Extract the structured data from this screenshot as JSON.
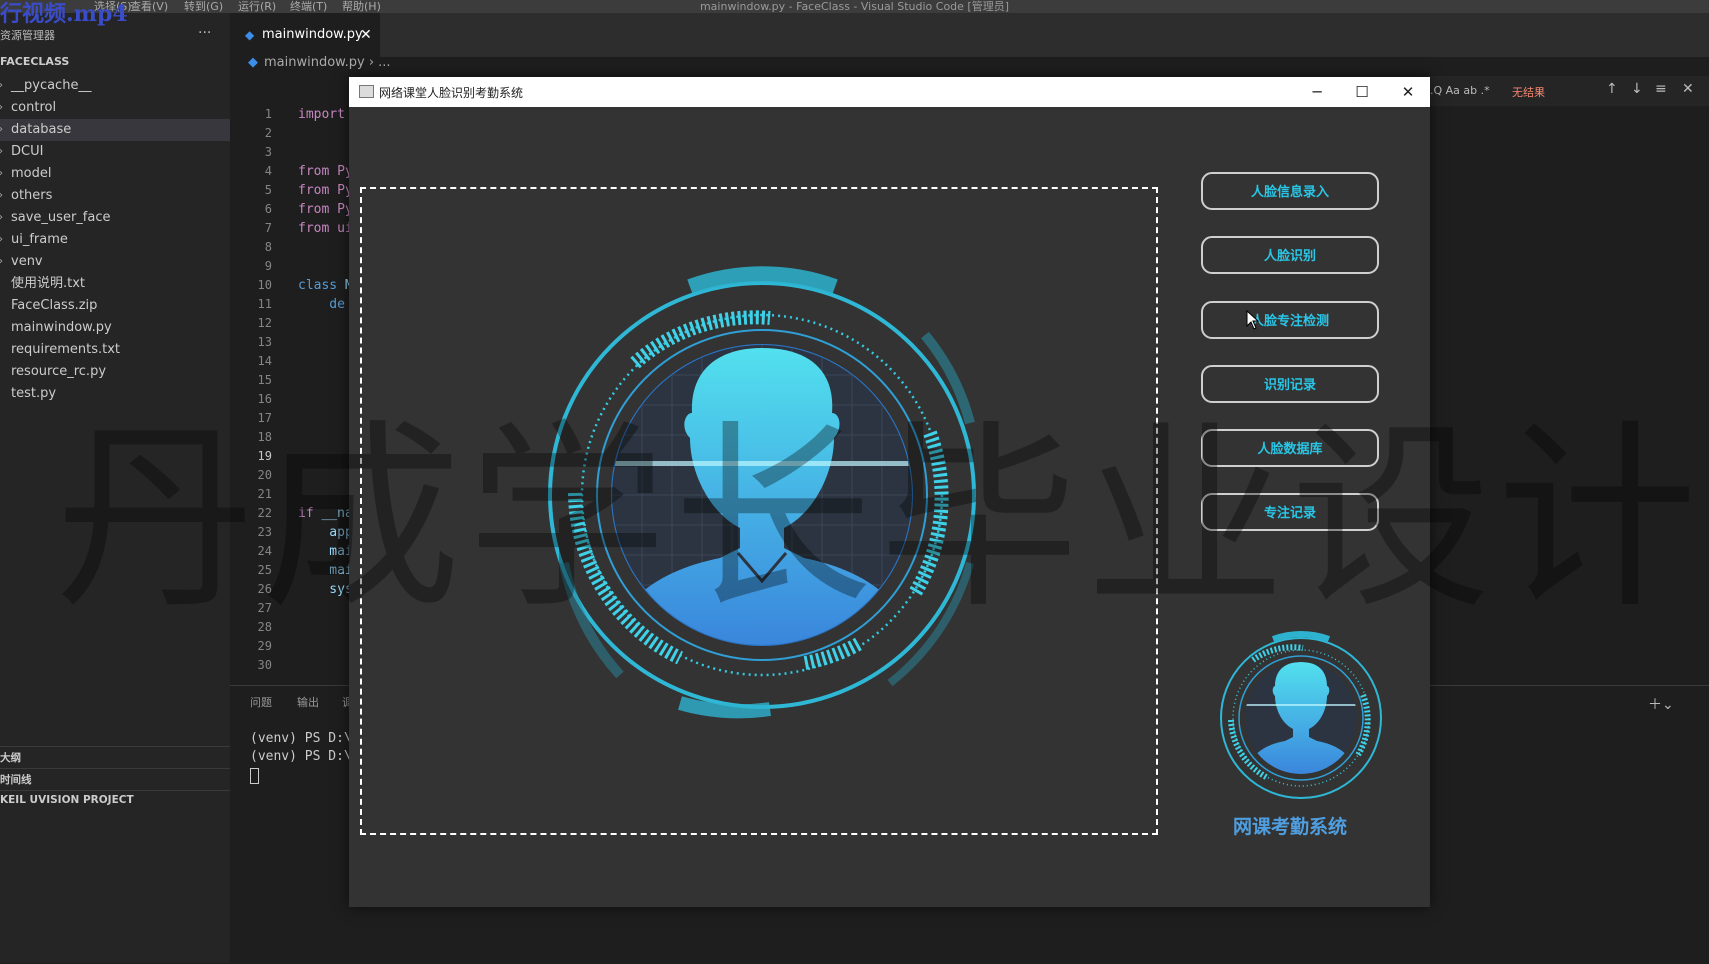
{
  "overlay_title": "行视频.mp4",
  "menubar": {
    "items": [
      "选择(S)",
      "查看(V)",
      "转到(G)",
      "运行(R)",
      "终端(T)",
      "帮助(H)"
    ],
    "title": "mainwindow.py - FaceClass - Visual Studio Code [管理员]"
  },
  "sidebar": {
    "title": "资源管理器",
    "more": "···",
    "root": "FACECLASS",
    "items": [
      {
        "label": "__pycache__",
        "chevron": "›"
      },
      {
        "label": "control",
        "chevron": "›"
      },
      {
        "label": "database",
        "chevron": "›"
      },
      {
        "label": "DCUI",
        "chevron": "›"
      },
      {
        "label": "model",
        "chevron": "›"
      },
      {
        "label": "others",
        "chevron": "›"
      },
      {
        "label": "save_user_face",
        "chevron": "›"
      },
      {
        "label": "ui_frame",
        "chevron": "›"
      },
      {
        "label": "venv",
        "chevron": "›"
      },
      {
        "label": "使用说明.txt",
        "chevron": ""
      },
      {
        "label": "FaceClass.zip",
        "chevron": ""
      },
      {
        "label": "mainwindow.py",
        "chevron": ""
      },
      {
        "label": "requirements.txt",
        "chevron": ""
      },
      {
        "label": "resource_rc.py",
        "chevron": ""
      },
      {
        "label": "test.py",
        "chevron": ""
      }
    ],
    "sections": [
      "大纲",
      "时间线",
      "KEIL UVISION PROJECT"
    ]
  },
  "editor": {
    "tab_label": "mainwindow.py",
    "breadcrumb": "mainwindow.py › ...",
    "line_numbers": [
      "1",
      "2",
      "3",
      "4",
      "5",
      "6",
      "7",
      "8",
      "9",
      "10",
      "11",
      "12",
      "13",
      "14",
      "15",
      "16",
      "17",
      "18",
      "19",
      "20",
      "21",
      "22",
      "23",
      "24",
      "25",
      "26",
      "27",
      "28",
      "29",
      "30"
    ],
    "code": {
      "l1": "import",
      "l4": "from Py",
      "l5": "from Py",
      "l6": "from Py",
      "l7": "from ui",
      "l10_kw": "class",
      "l10_id": " M",
      "l11": "    de",
      "l22_kw": "if",
      "l22_id": " __na",
      "l23": "    app",
      "l24": "    mai",
      "l25": "    mai",
      "l26": "    sys"
    }
  },
  "findwidget": {
    "options": ".Q Aa ab .*",
    "no_results": "无结果"
  },
  "panel": {
    "tabs": [
      "问题",
      "输出",
      "调"
    ],
    "terminal_lines": [
      "(venv) PS D:\\P",
      "(venv) PS D:\\P"
    ]
  },
  "app_window": {
    "title": "网络课堂人脸识别考勤系统",
    "buttons": [
      {
        "id": "face-enroll",
        "label": "人脸信息录入"
      },
      {
        "id": "face-recognize",
        "label": "人脸识别"
      },
      {
        "id": "focus-detect",
        "label": "人脸专注检测"
      },
      {
        "id": "recognition-records",
        "label": "识别记录"
      },
      {
        "id": "face-database",
        "label": "人脸数据库"
      },
      {
        "id": "focus-records",
        "label": "专注记录"
      }
    ],
    "logo_text": "网课考勤系统",
    "accent_color": "#29c6e6"
  },
  "watermark": "丹成学长毕业设计"
}
